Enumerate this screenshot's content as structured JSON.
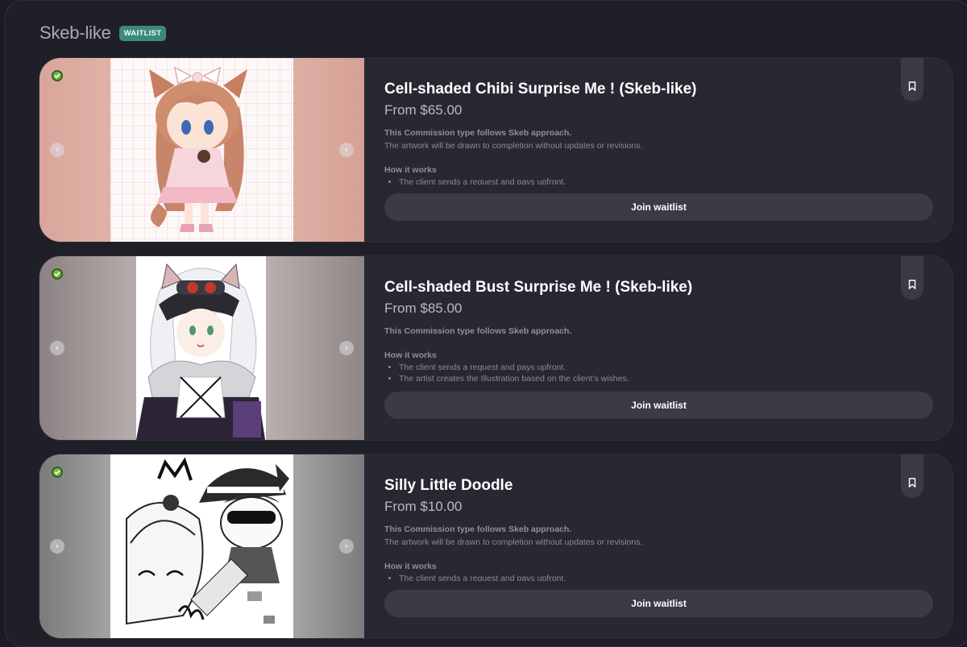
{
  "section": {
    "title": "Skeb-like",
    "badge": "WAITLIST"
  },
  "cards": [
    {
      "title": "Cell-shaded Chibi Surprise Me ! (Skeb-like)",
      "price": "From $65.00",
      "desc_heading": "This Commission type follows Skeb approach.",
      "desc_text": "The artwork will be drawn to completion without updates or revisions.",
      "how_heading": "How it works",
      "bullets": [
        "The client sends a request and pays upfront."
      ],
      "button": "Join waitlist"
    },
    {
      "title": "Cell-shaded Bust Surprise Me ! (Skeb-like)",
      "price": "From $85.00",
      "desc_heading": "This Commission type follows Skeb approach.",
      "desc_text": "",
      "how_heading": "How it works",
      "bullets": [
        "The client sends a request and pays upfront.",
        "The artist creates the Illustration based on the client's wishes."
      ],
      "button": "Join waitlist"
    },
    {
      "title": "Silly Little Doodle",
      "price": "From $10.00",
      "desc_heading": "This Commission type follows Skeb approach.",
      "desc_text": "The artwork will be drawn to completion without updates or revisions.",
      "how_heading": "How it works",
      "bullets": [
        "The client sends a request and pays upfront."
      ],
      "button": "Join waitlist"
    }
  ],
  "icons": {
    "verified": "check-circle-icon",
    "prev": "chevron-left-icon",
    "next": "chevron-right-icon",
    "bookmark": "bookmark-icon"
  }
}
